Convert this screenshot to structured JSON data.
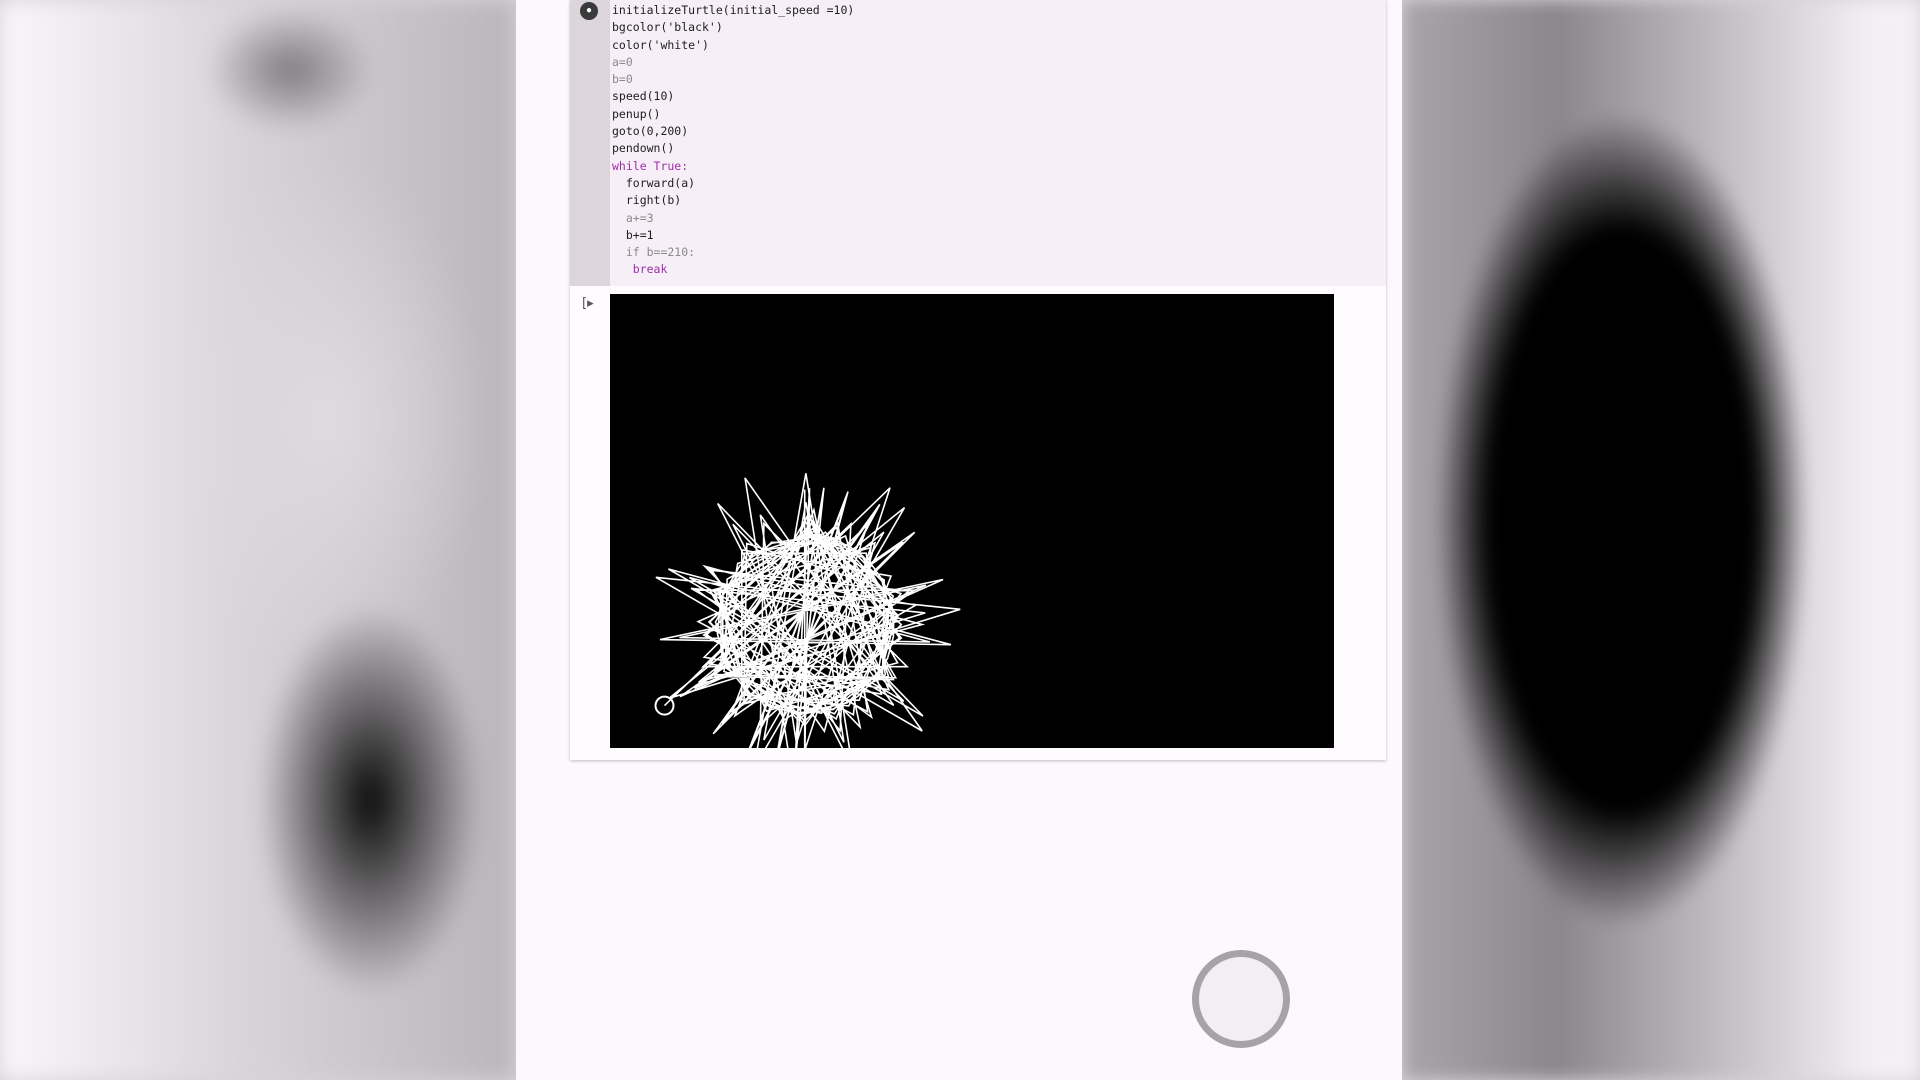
{
  "notebook": {
    "code_lines": [
      "initializeTurtle(initial_speed =10)",
      "bgcolor('black')",
      "color('white')",
      "a=0",
      "b=0",
      "speed(10)",
      "penup()",
      "goto(0,200)",
      "pendown()",
      "while True:",
      "  forward(a)",
      "  right(b)",
      "  a+=3",
      "  b+=1",
      "  if b==210:",
      "   break"
    ],
    "run_button_glyph": "●",
    "output_icon_glyph": "[▸"
  },
  "turtle_canvas": {
    "background": "#000000",
    "pen_color": "#ffffff"
  },
  "colors": {
    "keyword": "#9c2fa8",
    "string": "#b03a2a",
    "number": "#0a7a5a"
  },
  "icons": {
    "run": "run-cell-icon",
    "output": "output-icon",
    "turtle": "turtle-cursor-icon",
    "home": "home-button"
  }
}
